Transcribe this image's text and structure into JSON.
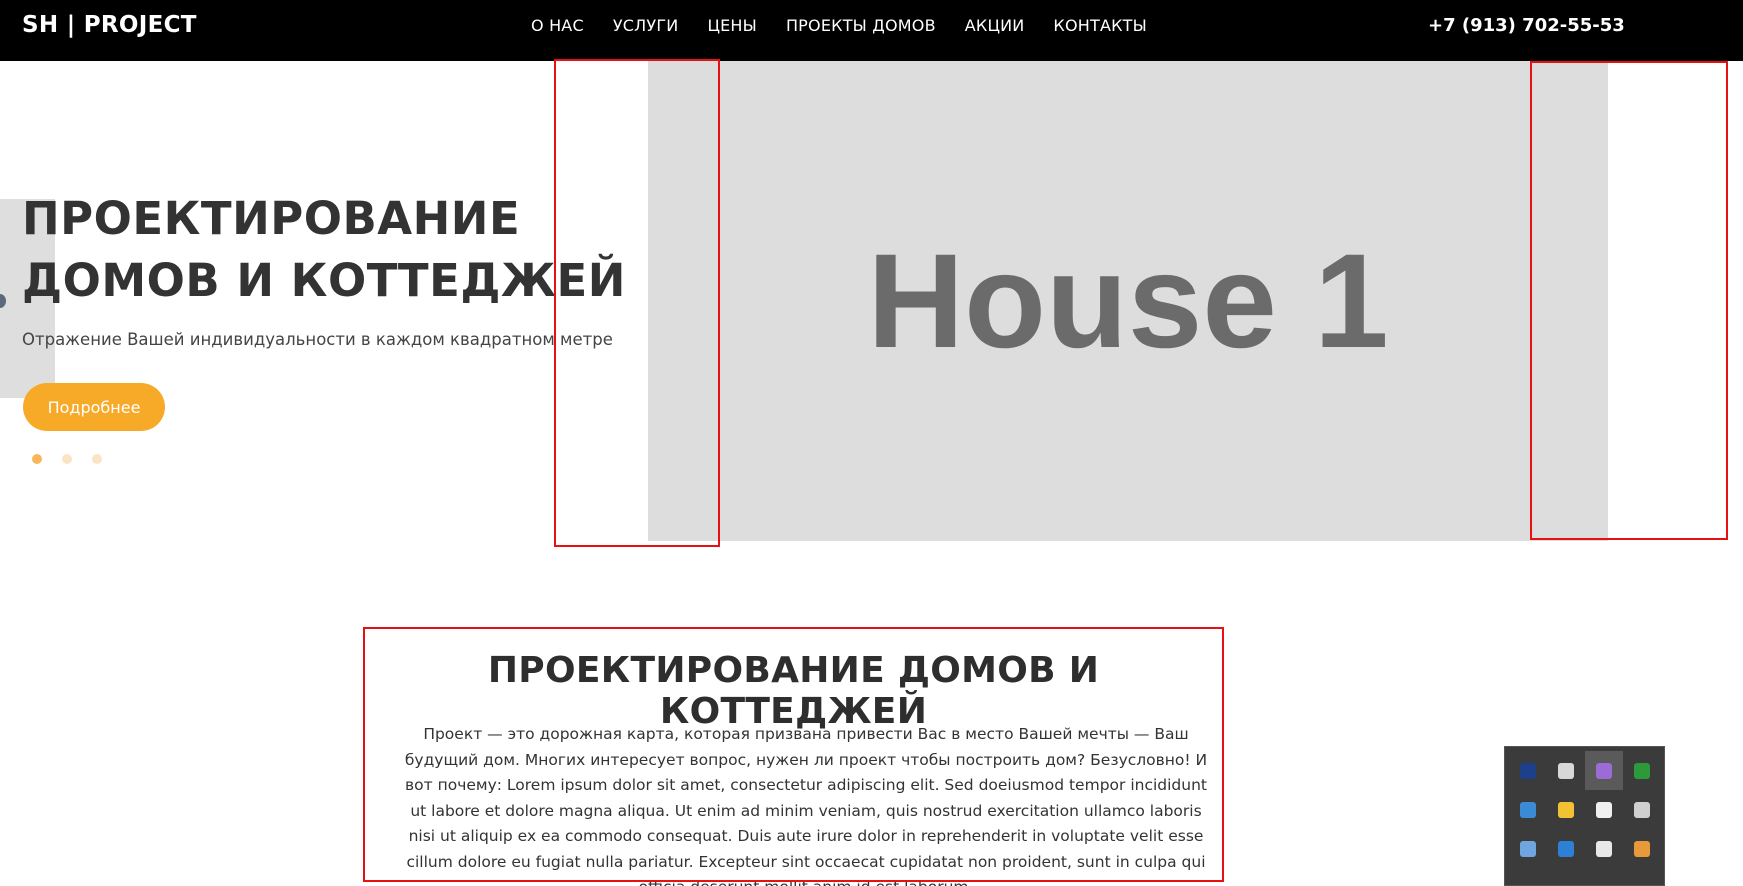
{
  "header": {
    "logo": "SH | PROJECT",
    "nav": [
      "О НАС",
      "УСЛУГИ",
      "ЦЕНЫ",
      "ПРОЕКТЫ ДОМОВ",
      "АКЦИИ",
      "КОНТАКТЫ"
    ],
    "phone": "+7 (913) 702-55-53"
  },
  "hero": {
    "title_line1": "ПРОЕКТИРОВАНИЕ",
    "title_line2": "ДОМОВ И КОТТЕДЖЕЙ",
    "subtitle": "Отражение Вашей индивидуальности в каждом квадратном метре",
    "button": "Подробнее",
    "slide_count": 3,
    "active_slide": 1,
    "image_label": "House 1"
  },
  "about": {
    "title": "ПРОЕКТИРОВАНИЕ ДОМОВ И КОТТЕДЖЕЙ",
    "text": "Проект — это дорожная карта, которая призвана привести Вас в место Вашей мечты — Ваш будущий дом. Многих интересует вопрос, нужен ли проект чтобы построить дом? Безусловно! И вот почему: Lorem ipsum dolor sit amet, consectetur adipiscing elit. Sed doeiusmod tempor incididunt ut labore et dolore magna aliqua. Ut enim ad minim veniam, quis nostrud exercitation ullamco laboris nisi ut aliquip ex ea commodo consequat. Duis aute irure dolor in reprehenderit in voluptate velit esse cillum dolore eu fugiat nulla pariatur. Excepteur sint occaecat cupidatat non proident, sunt in culpa qui officia deserunt mollit anim id est laborum."
  },
  "tray": {
    "icons": [
      {
        "name": "lock-app-icon",
        "color": "#1e3f8a"
      },
      {
        "name": "satellite-icon",
        "color": "#d8d8d8"
      },
      {
        "name": "feather-icon",
        "color": "#9b6bd6"
      },
      {
        "name": "monitor-icon",
        "color": "#2c9a3a"
      },
      {
        "name": "globe-icon",
        "color": "#3a8ad6"
      },
      {
        "name": "emoji-icon",
        "color": "#f2c232"
      },
      {
        "name": "shield-warning-icon",
        "color": "#f0f0f0"
      },
      {
        "name": "network-icon",
        "color": "#d0d0d0"
      },
      {
        "name": "usb-icon",
        "color": "#6fa6e0"
      },
      {
        "name": "chat-icon",
        "color": "#2e7fd6"
      },
      {
        "name": "speaker-icon",
        "color": "#e8e8e8"
      },
      {
        "name": "browser-icon",
        "color": "#e89a3a"
      }
    ]
  },
  "colors": {
    "accent": "#f7a928",
    "header_bg": "#000000",
    "placeholder_bg": "#dddddd",
    "annotation": "#e81010"
  }
}
